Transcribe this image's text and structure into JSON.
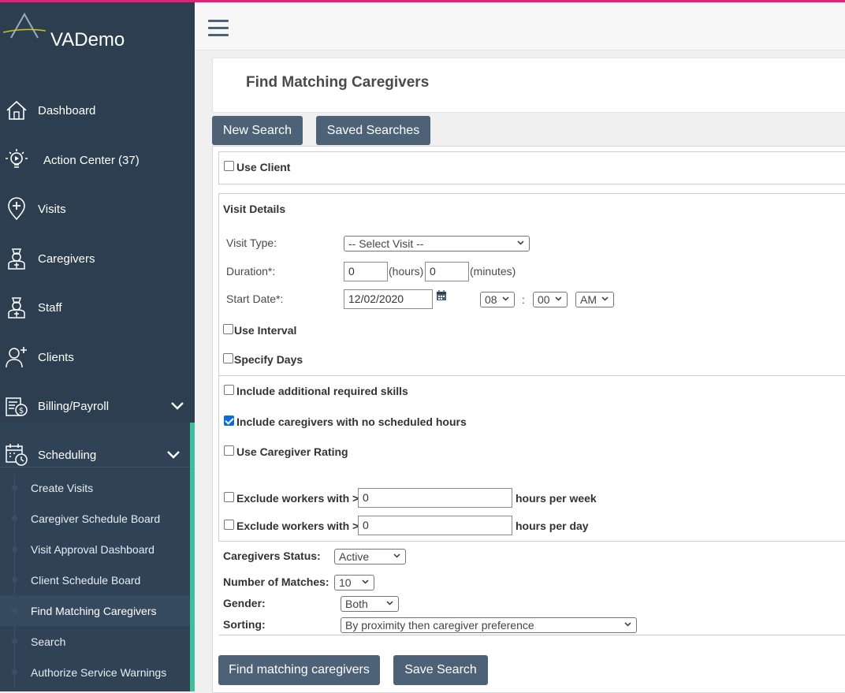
{
  "app": {
    "name": "VADemo"
  },
  "sidebar": {
    "items": [
      {
        "label": "Dashboard",
        "icon": "house-icon"
      },
      {
        "label": "Action Center (37)",
        "icon": "lightbulb-icon"
      },
      {
        "label": "Visits",
        "icon": "location-plus-icon"
      },
      {
        "label": "Caregivers",
        "icon": "caregiver-badge-icon"
      },
      {
        "label": "Staff",
        "icon": "staff-badge-icon"
      },
      {
        "label": "Clients",
        "icon": "client-person-icon"
      },
      {
        "label": "Billing/Payroll",
        "icon": "billing-dollar-icon"
      },
      {
        "label": "Scheduling",
        "icon": "calendar-clock-icon"
      }
    ],
    "scheduling_sub": [
      "Create Visits",
      "Caregiver Schedule Board",
      "Visit Approval Dashboard",
      "Client Schedule Board",
      "Find Matching Caregivers",
      "Search",
      "Authorize Service Warnings"
    ],
    "active_sub": "Find Matching Caregivers"
  },
  "page": {
    "title": "Find Matching Caregivers"
  },
  "tabs": {
    "new_search": "New Search",
    "saved_searches": "Saved Searches"
  },
  "form": {
    "use_client": "Use Client",
    "visit_details": "Visit Details",
    "visit_type_label": "Visit Type:",
    "visit_type_value": "-- Select Visit --",
    "duration_label": "Duration*:",
    "duration_hours": "0",
    "hours_unit": "(hours)",
    "duration_minutes": "0",
    "minutes_unit": "(minutes)",
    "start_date_label": "Start Date*:",
    "start_date_value": "12/02/2020",
    "hour_value": "08",
    "time_separator": ":",
    "minute_value": "00",
    "ampm_value": "AM",
    "use_interval": "Use Interval",
    "specify_days": "Specify Days",
    "include_skills": "Include additional required skills",
    "include_no_hours": "Include caregivers with no scheduled hours",
    "include_no_hours_checked": true,
    "use_rating": "Use Caregiver Rating",
    "exclude_label": "Exclude workers with >",
    "exclude_week_value": "0",
    "per_week": "hours per week",
    "exclude_day_value": "0",
    "per_day": "hours per day",
    "status_label": "Caregivers Status:",
    "status_value": "Active",
    "matches_label": "Number of Matches:",
    "matches_value": "10",
    "gender_label": "Gender:",
    "gender_value": "Both",
    "sorting_label": "Sorting:",
    "sorting_value": "By proximity then caregiver preference"
  },
  "actions": {
    "find": "Find matching caregivers",
    "save": "Save Search"
  },
  "colors": {
    "sidebar_bg": "#2c3e50",
    "button_bg": "#4d6277",
    "accent_green": "#3fbf9b",
    "top_accent": "#e8207a"
  }
}
